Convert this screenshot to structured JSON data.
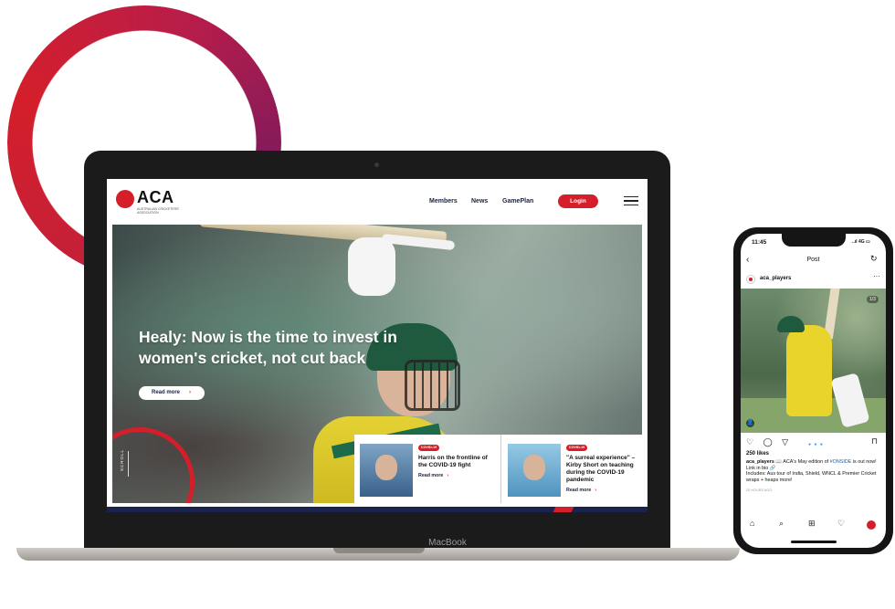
{
  "site": {
    "logo_text": "ACA",
    "logo_subtitle": "AUSTRALIAN CRICKETERS' ASSOCIATION",
    "nav": [
      "Members",
      "News",
      "GamePlan"
    ],
    "login_label": "Login",
    "hero_title": "Healy: Now is the time to invest in women's cricket, not cut back",
    "read_more": "Read more",
    "scroll_label": "SCROLL",
    "cards": [
      {
        "badge": "COVID-19",
        "title": "Harris on the frontline of the COVID-19 fight",
        "more": "Read more"
      },
      {
        "badge": "COVID-19",
        "title": "\"A surreal experience\" – Kirby Short on teaching during the COVID-19 pandemic",
        "more": "Read more"
      }
    ],
    "accent_color": "#d41f2b",
    "navy_color": "#1a2340"
  },
  "laptop": {
    "brand": "MacBook"
  },
  "phone": {
    "time": "11:45",
    "status": "..ıl 4G ▭",
    "header": "Post",
    "username": "aca_players",
    "image_counter": "1/3",
    "likes": "250 likes",
    "caption_user": "aca_players",
    "caption_text": "📖 ACA's May edition of ",
    "caption_tag": "#ONSIDE",
    "caption_rest": " is out now! Link in bio 🔗",
    "caption_line2": "Includes: Aus tour of India, Shield, WNCL & Premier Cricket wraps + heaps more!",
    "time_ago": "20 HOURS AGO",
    "icons": {
      "back": "‹",
      "refresh": "↻",
      "more": "···",
      "actions": "♡ ◯ ▽",
      "save": "⊓",
      "tag": "👤",
      "pager": "● ● ●",
      "tabs": [
        "⌂",
        "⌕",
        "⊞",
        "♡"
      ]
    }
  }
}
